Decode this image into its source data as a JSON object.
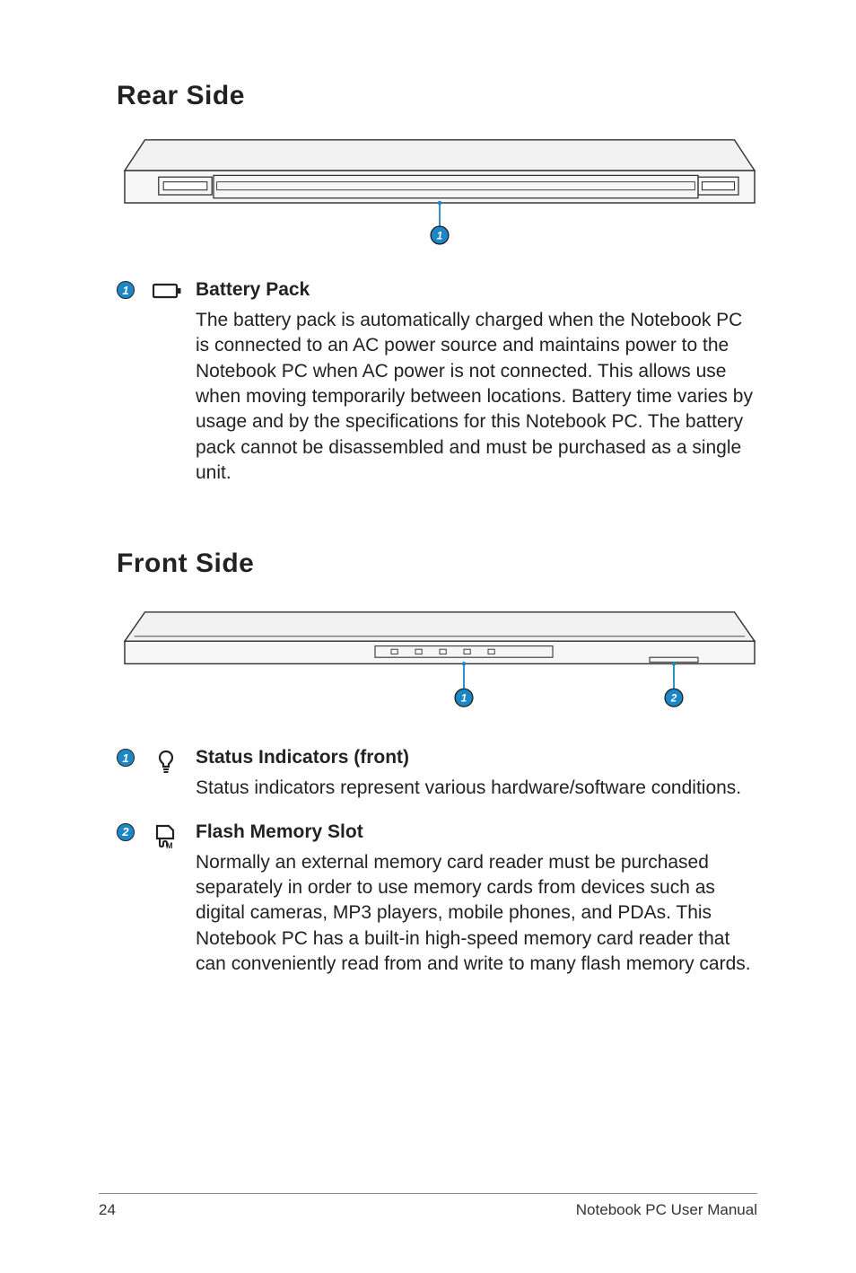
{
  "section1": {
    "title": "Rear Side",
    "item1": {
      "num": "1",
      "title": "Battery Pack",
      "body": "The battery pack is automatically charged when the Notebook PC is connected to an AC power source and maintains power to the Notebook PC when AC power is not connected. This allows use when moving temporarily between locations. Battery time varies by usage and by the specifications for this Notebook PC. The battery pack cannot be disassembled and must be purchased as a single unit."
    }
  },
  "section2": {
    "title": "Front Side",
    "item1": {
      "num": "1",
      "title": "Status Indicators (front)",
      "body": "Status indicators represent various hardware/software conditions."
    },
    "item2": {
      "num": "2",
      "title": "Flash Memory Slot",
      "body": "Normally an external memory card reader must be purchased separately in order to use memory cards from devices such as digital cameras, MP3 players, mobile phones, and PDAs. This Notebook PC has a built-in high-speed memory card reader that can conveniently read from and write to many flash memory cards."
    }
  },
  "footer": {
    "page": "24",
    "source": "Notebook PC User Manual"
  }
}
